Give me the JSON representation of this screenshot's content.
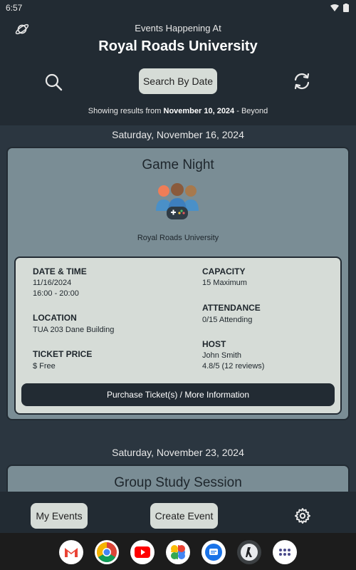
{
  "status": {
    "time": "6:57"
  },
  "header": {
    "subtitle": "Events Happening At",
    "title": "Royal Roads University",
    "date_button": "Search By Date",
    "results_prefix": "Showing results from ",
    "results_date": "November 10, 2024",
    "results_suffix": " - Beyond"
  },
  "events": [
    {
      "date_heading": "Saturday, November 16, 2024",
      "title": "Game Night",
      "organization": "Royal Roads University",
      "labels": {
        "datetime": "DATE & TIME",
        "location": "LOCATION",
        "price": "TICKET PRICE",
        "capacity": "CAPACITY",
        "attendance": "ATTENDANCE",
        "host": "HOST"
      },
      "date": "11/16/2024",
      "time": "16:00 - 20:00",
      "location": "TUA 203 Dane Building",
      "price": "$ Free",
      "capacity": "15 Maximum",
      "attendance": "0/15 Attending",
      "host_name": "John Smith",
      "host_rating": "4.8/5 (12 reviews)",
      "purchase_label": "Purchase Ticket(s) / More Information"
    },
    {
      "date_heading": "Saturday, November 23, 2024",
      "title": "Group Study Session"
    }
  ],
  "bottom": {
    "my_events": "My Events",
    "create_event": "Create Event"
  },
  "dock": {
    "apps": [
      "gmail-icon",
      "chrome-icon",
      "youtube-icon",
      "photos-icon",
      "messages-icon",
      "app-icon",
      "app-drawer-icon"
    ]
  },
  "colors": {
    "background": "#2b3640",
    "header": "#222b33",
    "card": "#7a8d95",
    "panel": "#d6dcd7"
  }
}
